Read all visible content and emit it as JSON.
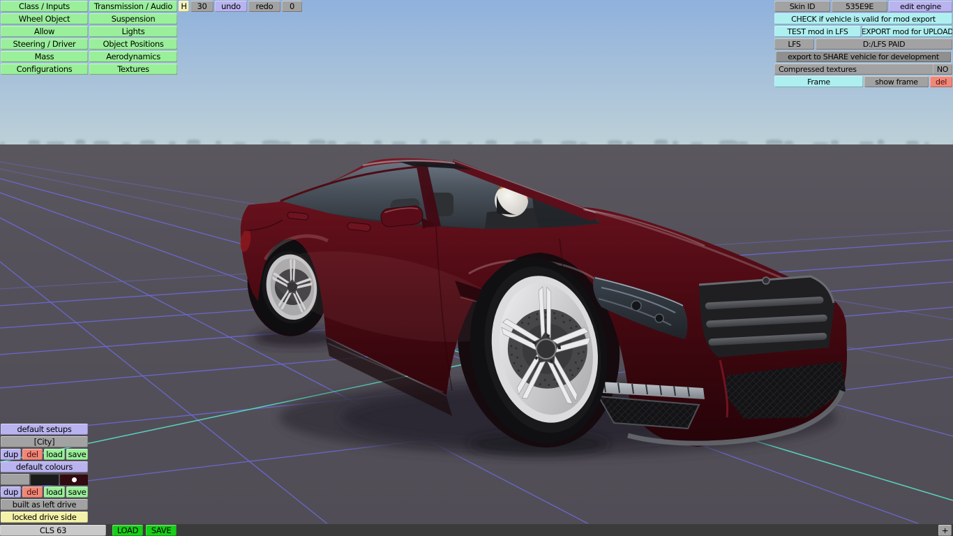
{
  "scene": {
    "vehicle": "CLS 63",
    "colors": {
      "sky_top": "#8fb1dc",
      "sky_horizon": "#bdd0d8",
      "ground": "#56525a",
      "grid_line": "#6b6bdb",
      "grid_accent": "#58dcc4",
      "car_body": "#5a0d18",
      "bar_bg": "#3b3b3c"
    }
  },
  "editor_menu": {
    "left": [
      "Class / Inputs",
      "Wheel Object",
      "Allow",
      "Steering / Driver",
      "Mass",
      "Configurations"
    ],
    "right": [
      "Transmission / Audio",
      "Suspension",
      "Lights",
      "Object Positions",
      "Aerodynamics",
      "Textures"
    ]
  },
  "history_bar": {
    "h_label": "H",
    "h_value": "30",
    "undo": "undo",
    "redo": "redo",
    "counter": "0"
  },
  "export_panel": {
    "skin_label": "Skin ID",
    "skin_value": "535E9E",
    "edit_engine": "edit engine",
    "check": "CHECK if vehicle is valid for mod export",
    "test": "TEST mod in LFS",
    "export_upload": "EXPORT mod for UPLOAD",
    "lfs": "LFS",
    "lfs_path": "D:/LFS PAID",
    "share": "export to SHARE vehicle for development",
    "compressed_label": "Compressed textures",
    "compressed_value": "NO",
    "frame": "Frame",
    "show_frame": "show frame",
    "frame_del": "del"
  },
  "setup_panel": {
    "default_setups": "default setups",
    "setup_name": "[City]",
    "actions": [
      "dup",
      "del",
      "load",
      "save"
    ],
    "default_colours": "default colours",
    "swatches": [
      "#a2a2a2",
      "#1b1b1b",
      "#310b10"
    ],
    "built": "built as left drive",
    "locked": "locked drive side"
  },
  "bottom_bar": {
    "vehicle": "CLS 63",
    "load": "LOAD",
    "save": "SAVE",
    "add": "+"
  }
}
